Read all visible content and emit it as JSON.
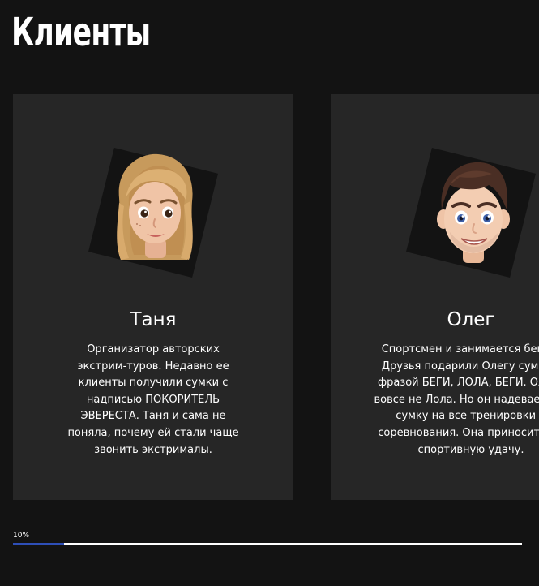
{
  "section": {
    "title": "Клиенты"
  },
  "clients": [
    {
      "name": "Таня",
      "description": "Организатор авторских экстрим-туров. Недавно ее клиенты получили сумки с надписью ПОКОРИТЕЛЬ ЭВЕРЕСТА. Таня и сама не поняла, почему ей стали чаще звонить экстрималы."
    },
    {
      "name": "Олег",
      "description": "Спортсмен и занимается бегом. Друзья подарили Олегу сумку с фразой БЕГИ, ЛОЛА, БЕГИ. Олег - вовсе не Лола. Но он надевает эту сумку на все тренировки и соревнования. Она приносит ему спортивную удачу."
    }
  ],
  "progress": {
    "label": "10%",
    "value": 0.1
  },
  "colors": {
    "background": "#131313",
    "card": "#262626",
    "accent": "#2e4fb8",
    "text": "#ffffff"
  }
}
